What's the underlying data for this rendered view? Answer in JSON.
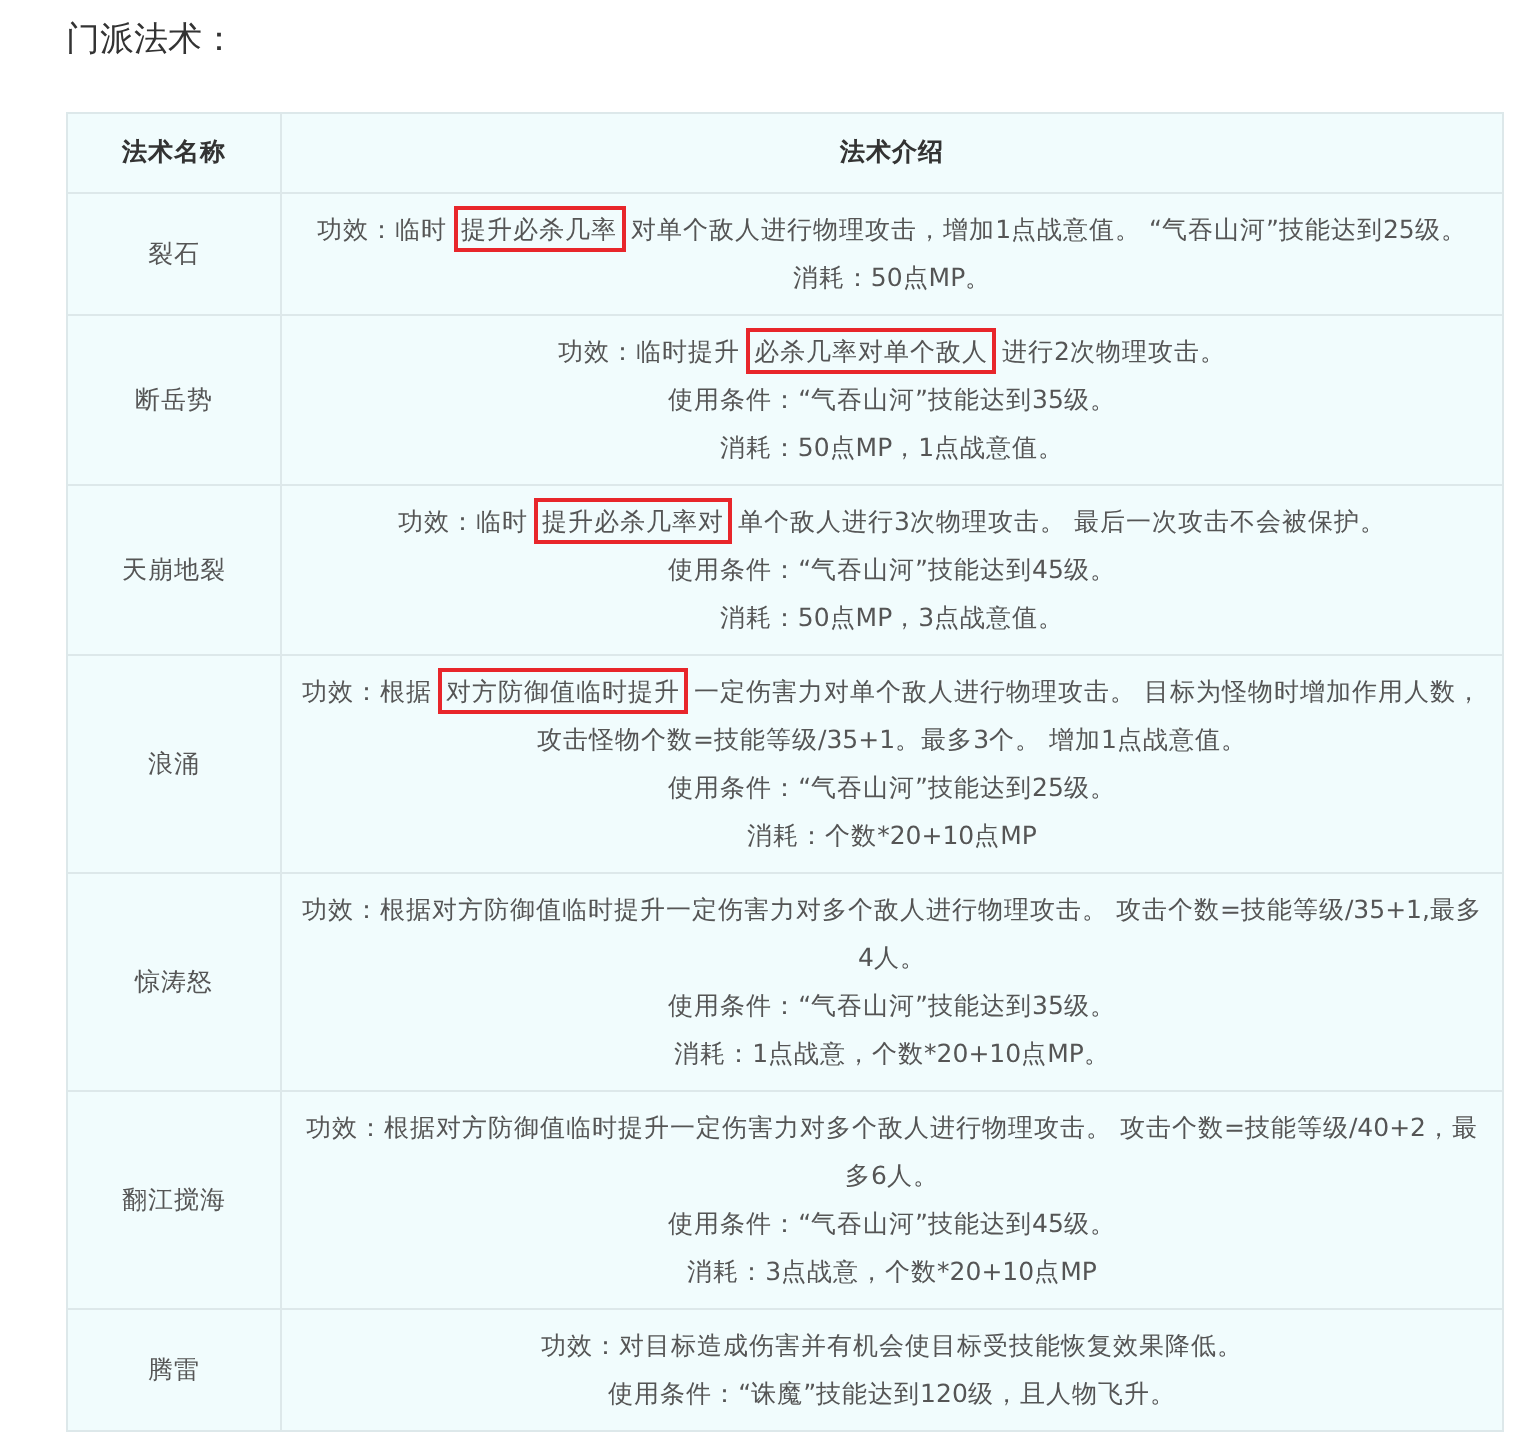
{
  "heading": "门派法术：",
  "table": {
    "columns": [
      "法术名称",
      "法术介绍"
    ],
    "rows": [
      {
        "name": "裂石",
        "lines": [
          {
            "kind": "highlighted",
            "parts": [
              "功效：临时",
              "提升必杀几率",
              "对单个敌人进行物理攻击，增加1点战意值。 “气吞山河”技能达到25级。"
            ]
          },
          {
            "kind": "plain",
            "text": "消耗：50点MP。"
          }
        ]
      },
      {
        "name": "断岳势",
        "lines": [
          {
            "kind": "highlighted",
            "parts": [
              "功效：临时提升",
              "必杀几率对单个敌人",
              "进行2次物理攻击。"
            ]
          },
          {
            "kind": "plain",
            "text": "使用条件：“气吞山河”技能达到35级。"
          },
          {
            "kind": "plain",
            "text": "消耗：50点MP，1点战意值。"
          }
        ]
      },
      {
        "name": "天崩地裂",
        "lines": [
          {
            "kind": "highlighted",
            "parts": [
              "功效：临时",
              "提升必杀几率对",
              "单个敌人进行3次物理攻击。 最后一次攻击不会被保护。"
            ]
          },
          {
            "kind": "plain",
            "text": "使用条件：“气吞山河”技能达到45级。"
          },
          {
            "kind": "plain",
            "text": "消耗：50点MP，3点战意值。"
          }
        ]
      },
      {
        "name": "浪涌",
        "lines": [
          {
            "kind": "highlighted",
            "parts": [
              "功效：根据",
              "对方防御值临时提升",
              "一定伤害力对单个敌人进行物理攻击。 目标为怪物时增加作用人数，攻击怪物个数=技能等级/35+1。最多3个。 增加1点战意值。"
            ]
          },
          {
            "kind": "plain",
            "text": "使用条件：“气吞山河”技能达到25级。"
          },
          {
            "kind": "plain",
            "text": "消耗：个数*20+10点MP"
          }
        ]
      },
      {
        "name": "惊涛怒",
        "lines": [
          {
            "kind": "plain",
            "text": "功效：根据对方防御值临时提升一定伤害力对多个敌人进行物理攻击。 攻击个数=技能等级/35+1,最多4人。"
          },
          {
            "kind": "plain",
            "text": "使用条件：“气吞山河”技能达到35级。"
          },
          {
            "kind": "plain",
            "text": "消耗：1点战意，个数*20+10点MP。"
          }
        ]
      },
      {
        "name": "翻江搅海",
        "lines": [
          {
            "kind": "plain",
            "text": "功效：根据对方防御值临时提升一定伤害力对多个敌人进行物理攻击。 攻击个数=技能等级/40+2，最多6人。"
          },
          {
            "kind": "plain",
            "text": "使用条件：“气吞山河”技能达到45级。"
          },
          {
            "kind": "plain",
            "text": "消耗：3点战意，个数*20+10点MP"
          }
        ]
      },
      {
        "name": "腾雷",
        "lines": [
          {
            "kind": "plain",
            "text": "功效：对目标造成伤害并有机会使目标受技能恢复效果降低。"
          },
          {
            "kind": "plain",
            "text": "使用条件：“诛魔”技能达到120级，且人物飞升。"
          }
        ]
      }
    ]
  }
}
